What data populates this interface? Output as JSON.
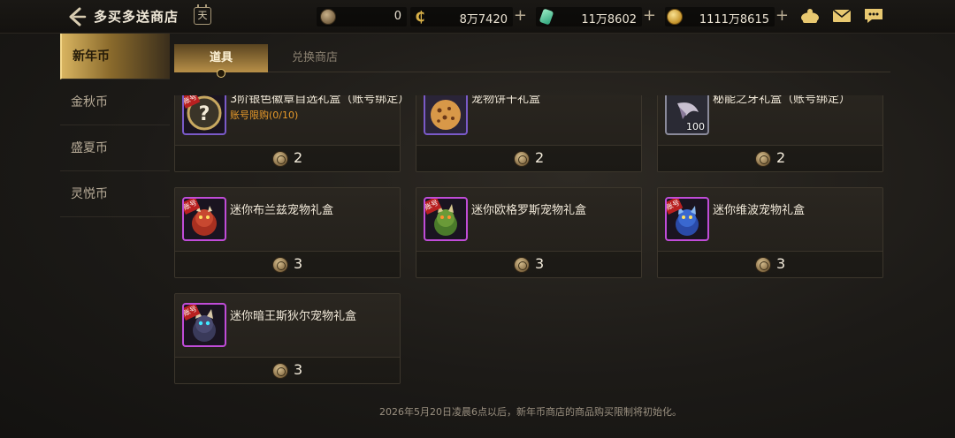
{
  "header": {
    "title": "多买多送商店",
    "calendar_label": "天"
  },
  "resources": [
    {
      "icon": "bronze-coin-icon",
      "value": "0"
    },
    {
      "icon": "c-coin-icon",
      "value": "8万7420"
    },
    {
      "icon": "green-gem-icon",
      "value": "11万8602"
    },
    {
      "icon": "gold-coin-icon",
      "value": "1111万8615"
    }
  ],
  "sidebar": {
    "items": [
      {
        "label": "新年币",
        "active": true
      },
      {
        "label": "金秋币",
        "active": false
      },
      {
        "label": "盛夏币",
        "active": false
      },
      {
        "label": "灵悦币",
        "active": false
      }
    ]
  },
  "tabs": [
    {
      "label": "道具",
      "active": true
    },
    {
      "label": "兑换商店",
      "active": false
    }
  ],
  "items": [
    {
      "name": "3阶银色徽章自选礼盒（账号绑定）",
      "limit": "账号限购(0/10)",
      "price": "2",
      "badge": "账号",
      "icon": "question-badge-icon",
      "qty": ""
    },
    {
      "name": "宠物饼干礼盒",
      "limit": "",
      "price": "2",
      "badge": "",
      "icon": "cookie-icon",
      "qty": ""
    },
    {
      "name": "秘能之牙礼盒（账号绑定）",
      "limit": "",
      "price": "2",
      "badge": "",
      "icon": "fang-icon",
      "qty": "100"
    },
    {
      "name": "迷你布兰兹宠物礼盒",
      "limit": "",
      "price": "3",
      "badge": "账号",
      "icon": "red-pet-icon",
      "qty": ""
    },
    {
      "name": "迷你欧格罗斯宠物礼盒",
      "limit": "",
      "price": "3",
      "badge": "账号",
      "icon": "green-pet-icon",
      "qty": ""
    },
    {
      "name": "迷你维波宠物礼盒",
      "limit": "",
      "price": "3",
      "badge": "账号",
      "icon": "blue-pet-icon",
      "qty": ""
    },
    {
      "name": "迷你暗王斯狄尔宠物礼盒",
      "limit": "",
      "price": "3",
      "badge": "账号",
      "icon": "dark-pet-icon",
      "qty": ""
    }
  ],
  "footer": {
    "note": "2026年5月20日凌晨6点以后，新年币商店的商品购买限制将初始化。"
  },
  "colors": {
    "accent_gold": "#d8b460",
    "limit_orange": "#e89a2a",
    "rarity_purple": "#c04cd8"
  }
}
